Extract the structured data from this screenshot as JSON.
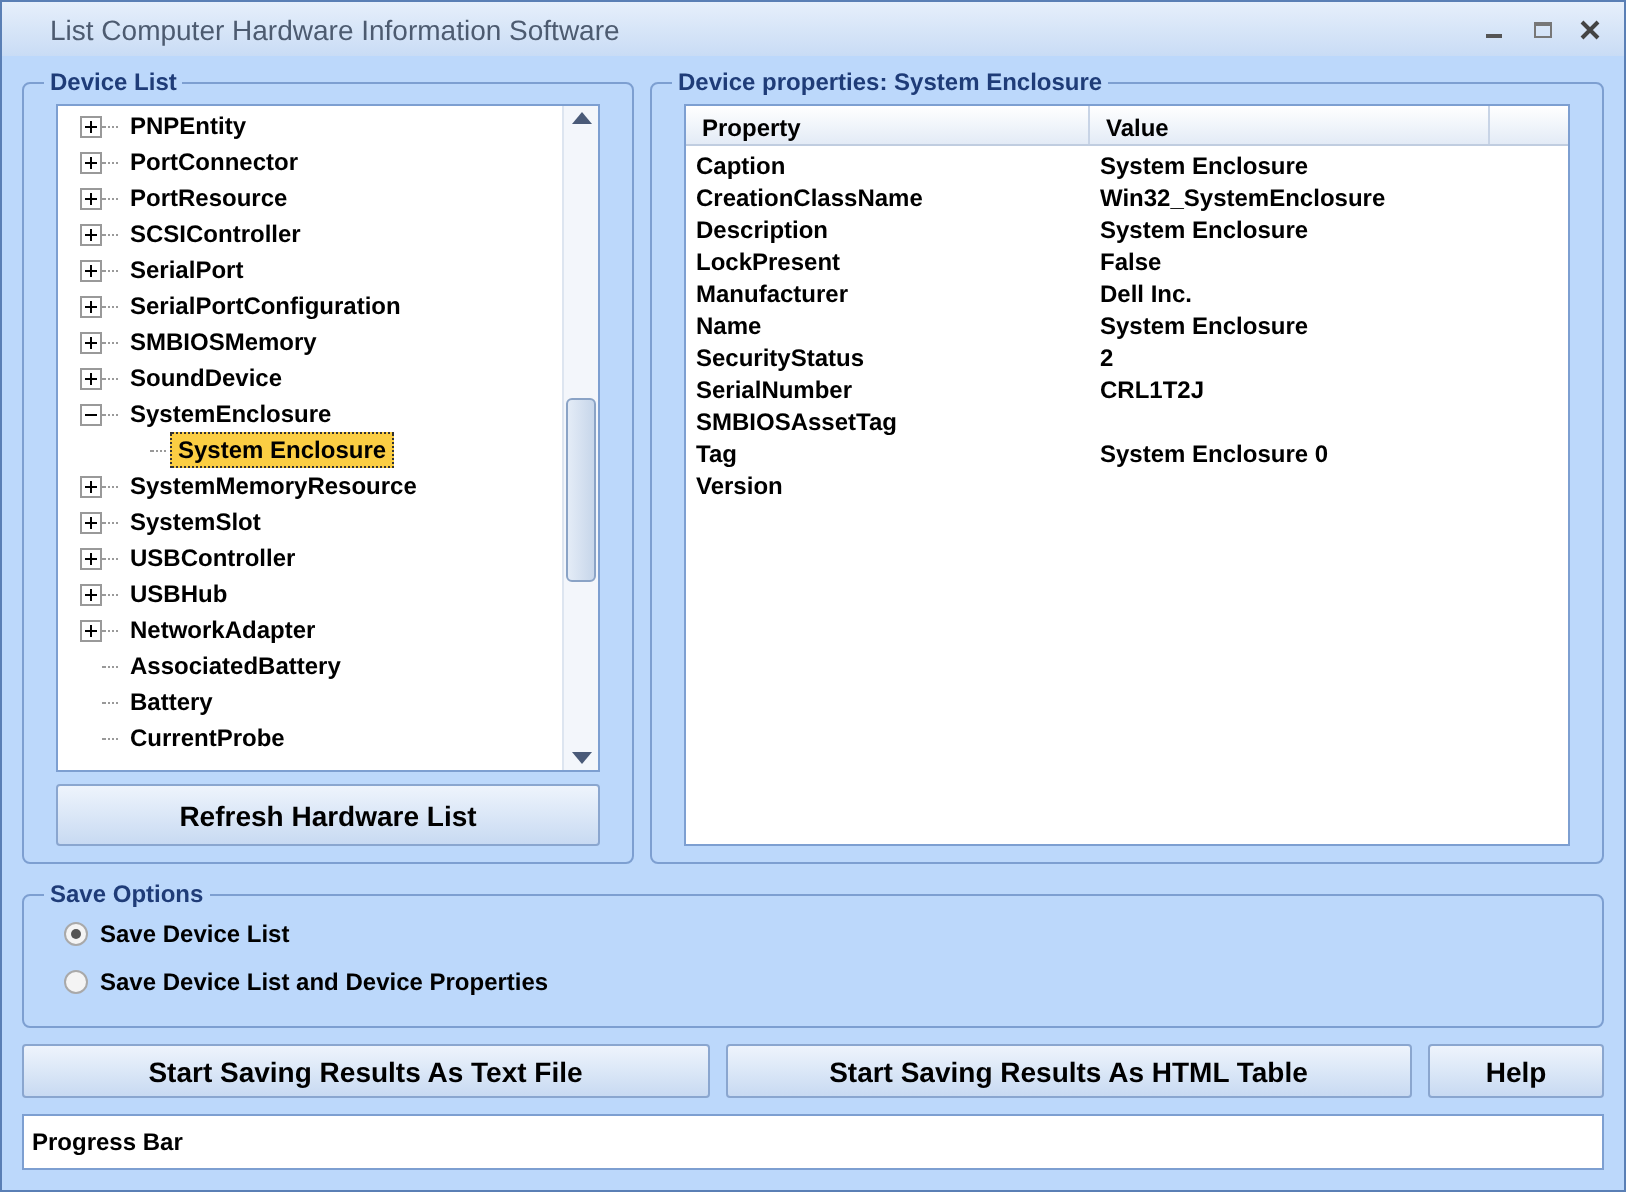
{
  "window": {
    "title": "List Computer Hardware Information Software"
  },
  "device_list": {
    "title": "Device List",
    "items": [
      {
        "label": "PNPEntity",
        "expandable": true,
        "expanded": false,
        "selected": false
      },
      {
        "label": "PortConnector",
        "expandable": true,
        "expanded": false,
        "selected": false
      },
      {
        "label": "PortResource",
        "expandable": true,
        "expanded": false,
        "selected": false
      },
      {
        "label": "SCSIController",
        "expandable": true,
        "expanded": false,
        "selected": false
      },
      {
        "label": "SerialPort",
        "expandable": true,
        "expanded": false,
        "selected": false
      },
      {
        "label": "SerialPortConfiguration",
        "expandable": true,
        "expanded": false,
        "selected": false
      },
      {
        "label": "SMBIOSMemory",
        "expandable": true,
        "expanded": false,
        "selected": false
      },
      {
        "label": "SoundDevice",
        "expandable": true,
        "expanded": false,
        "selected": false
      },
      {
        "label": "SystemEnclosure",
        "expandable": true,
        "expanded": true,
        "selected": false,
        "children": [
          {
            "label": "System Enclosure",
            "expandable": false,
            "selected": true
          }
        ]
      },
      {
        "label": "SystemMemoryResource",
        "expandable": true,
        "expanded": false,
        "selected": false
      },
      {
        "label": "SystemSlot",
        "expandable": true,
        "expanded": false,
        "selected": false
      },
      {
        "label": "USBController",
        "expandable": true,
        "expanded": false,
        "selected": false
      },
      {
        "label": "USBHub",
        "expandable": true,
        "expanded": false,
        "selected": false
      },
      {
        "label": "NetworkAdapter",
        "expandable": true,
        "expanded": false,
        "selected": false
      },
      {
        "label": "AssociatedBattery",
        "expandable": false,
        "selected": false
      },
      {
        "label": "Battery",
        "expandable": false,
        "selected": false
      },
      {
        "label": "CurrentProbe",
        "expandable": false,
        "selected": false
      }
    ],
    "refresh_button": "Refresh Hardware List"
  },
  "properties": {
    "title": "Device properties: System Enclosure",
    "columns": [
      "Property",
      "Value"
    ],
    "rows": [
      [
        "Caption",
        "System Enclosure"
      ],
      [
        "CreationClassName",
        "Win32_SystemEnclosure"
      ],
      [
        "Description",
        "System Enclosure"
      ],
      [
        "LockPresent",
        "False"
      ],
      [
        "Manufacturer",
        "Dell Inc."
      ],
      [
        "Name",
        "System Enclosure"
      ],
      [
        "SecurityStatus",
        "2"
      ],
      [
        "SerialNumber",
        "CRL1T2J"
      ],
      [
        "SMBIOSAssetTag",
        ""
      ],
      [
        "Tag",
        "System Enclosure 0"
      ],
      [
        "Version",
        ""
      ]
    ]
  },
  "save_options": {
    "title": "Save Options",
    "options": [
      {
        "label": "Save Device List",
        "selected": true
      },
      {
        "label": "Save Device List and Device Properties",
        "selected": false
      }
    ]
  },
  "buttons": [
    "Start Saving Results As Text File",
    "Start Saving Results As HTML Table",
    "Help"
  ],
  "progress_bar": {
    "label": "Progress Bar"
  }
}
